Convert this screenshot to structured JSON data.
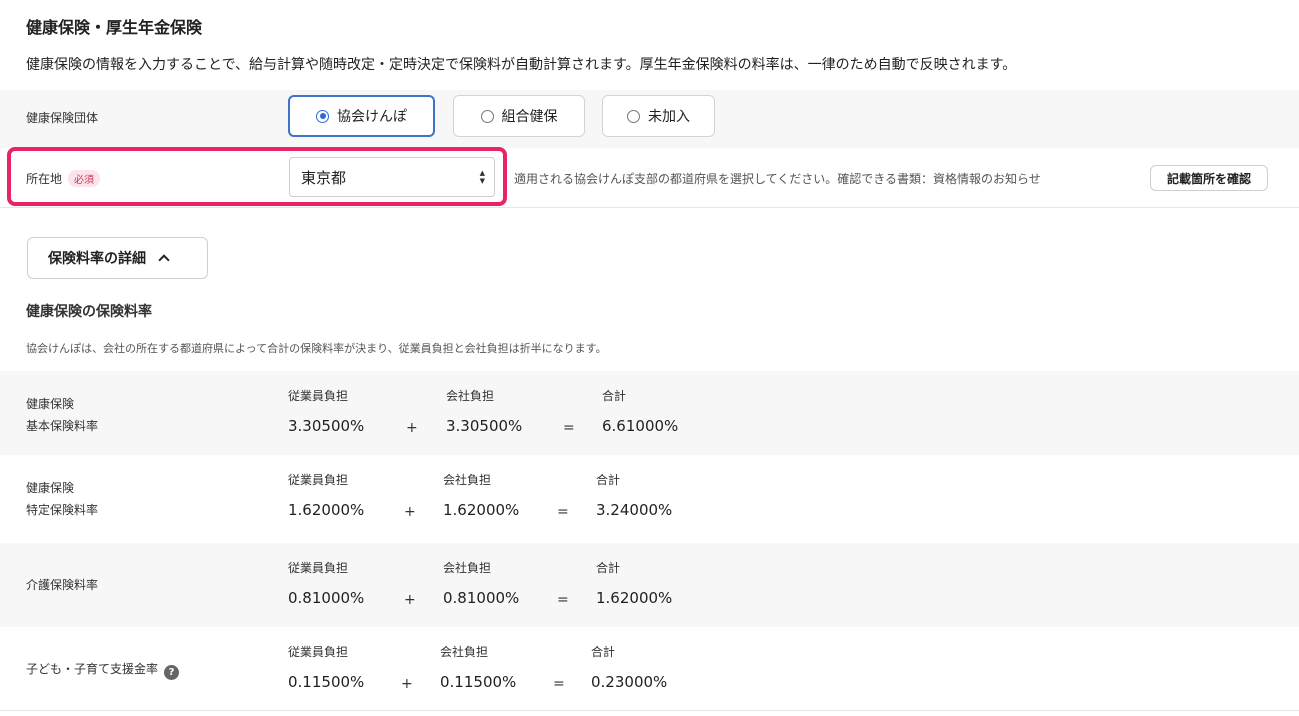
{
  "header": {
    "title": "健康保険・厚生年金保険",
    "description": "健康保険の情報を入力することで、給与計算や随時改定・定時決定で保険料が自動計算されます。厚生年金保険料の料率は、一律のため自動で反映されます。"
  },
  "insurer": {
    "label": "健康保険団体",
    "options": [
      "協会けんぽ",
      "組合健保",
      "未加入"
    ],
    "selected": "協会けんぽ"
  },
  "location": {
    "label": "所在地",
    "required_badge": "必須",
    "selected": "東京都",
    "hint": "適用される協会けんぽ支部の都道府県を選択してください。確認できる書類：資格情報のお知らせ",
    "confirm_button": "記載箇所を確認"
  },
  "details_toggle": {
    "label": "保険料率の詳細"
  },
  "rates_section": {
    "title": "健康保険の保険料率",
    "description": "協会けんぽは、会社の所在する都道府県によって合計の保険料率が決まり、従業員負担と会社負担は折半になります。"
  },
  "rate_columns": {
    "employee": "従業員負担",
    "company": "会社負担",
    "total": "合計",
    "plus": "+",
    "equals": "="
  },
  "rates": [
    {
      "label_line1": "健康保険",
      "label_line2": "基本保険料率",
      "employee": "3.30500%",
      "company": "3.30500%",
      "total": "6.61000%"
    },
    {
      "label_line1": "健康保険",
      "label_line2": "特定保険料率",
      "employee": "1.62000%",
      "company": "1.62000%",
      "total": "3.24000%"
    },
    {
      "label_line1": "介護保険料率",
      "label_line2": "",
      "employee": "0.81000%",
      "company": "0.81000%",
      "total": "1.62000%"
    },
    {
      "label_line1": "子ども・子育て支援金率",
      "label_line2": "",
      "employee": "0.11500%",
      "company": "0.11500%",
      "total": "0.23000%"
    }
  ],
  "icons": {
    "help": "?",
    "select_arrow_up": "▲",
    "select_arrow_down": "▼"
  },
  "colors": {
    "accent": "#2e6bd1",
    "highlight": "#e8236a"
  }
}
